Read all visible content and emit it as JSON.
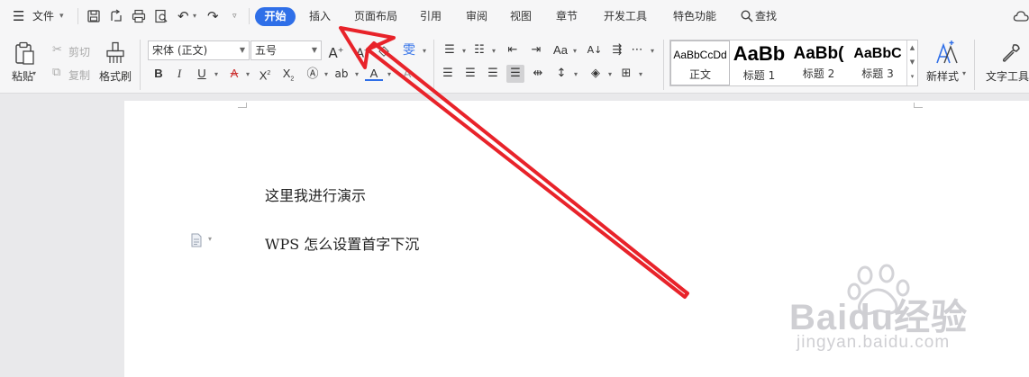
{
  "menubar": {
    "file_label": "文件",
    "tabs": [
      "开始",
      "插入",
      "页面布局",
      "引用",
      "审阅",
      "视图",
      "章节",
      "开发工具",
      "特色功能"
    ],
    "search_label": "查找"
  },
  "ribbon": {
    "paste_label": "粘贴",
    "cut_label": "剪切",
    "copy_label": "复制",
    "format_painter_label": "格式刷",
    "font_name": "宋体 (正文)",
    "font_size": "五号",
    "styles": [
      {
        "preview": "AaBbCcDd",
        "label": "正文"
      },
      {
        "preview": "AaBb",
        "label": "标题 1"
      },
      {
        "preview": "AaBb(",
        "label": "标题 2"
      },
      {
        "preview": "AaBbC",
        "label": "标题 3"
      }
    ],
    "new_style_label": "新样式",
    "text_tools_label": "文字工具"
  },
  "document": {
    "lines": [
      "这里我进行演示",
      "WPS 怎么设置首字下沉"
    ]
  },
  "watermark": {
    "brand": "Baidu经验",
    "url": "jingyan.baidu.com"
  },
  "colors": {
    "accent": "#2f6fe8",
    "arrow": "#e8232a"
  }
}
